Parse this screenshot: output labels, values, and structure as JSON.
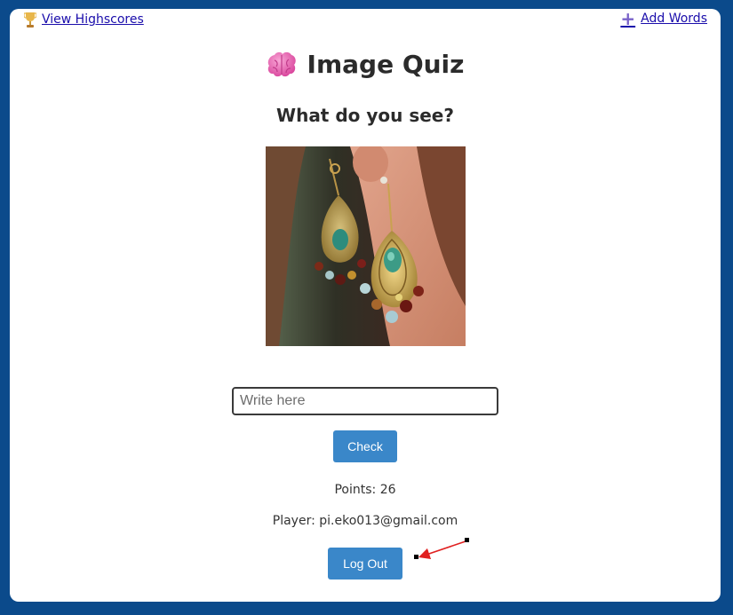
{
  "header": {
    "highscores_label": "View Highscores",
    "add_words_label": "Add Words"
  },
  "quiz": {
    "title": "Image Quiz",
    "question": "What do you see?",
    "answer_placeholder": "Write here",
    "answer_value": "",
    "check_label": "Check"
  },
  "status": {
    "points": "Points: 26",
    "player": "Player: pi.eko013@gmail.com"
  },
  "actions": {
    "logout_label": "Log Out"
  },
  "icons": {
    "highscores": "trophy-icon",
    "add_words": "plus-icon",
    "title": "brain-icon"
  },
  "colors": {
    "background": "#0b4a8b",
    "button": "#3a87c9",
    "link": "#1a0dab",
    "annotation": "#e02020"
  }
}
